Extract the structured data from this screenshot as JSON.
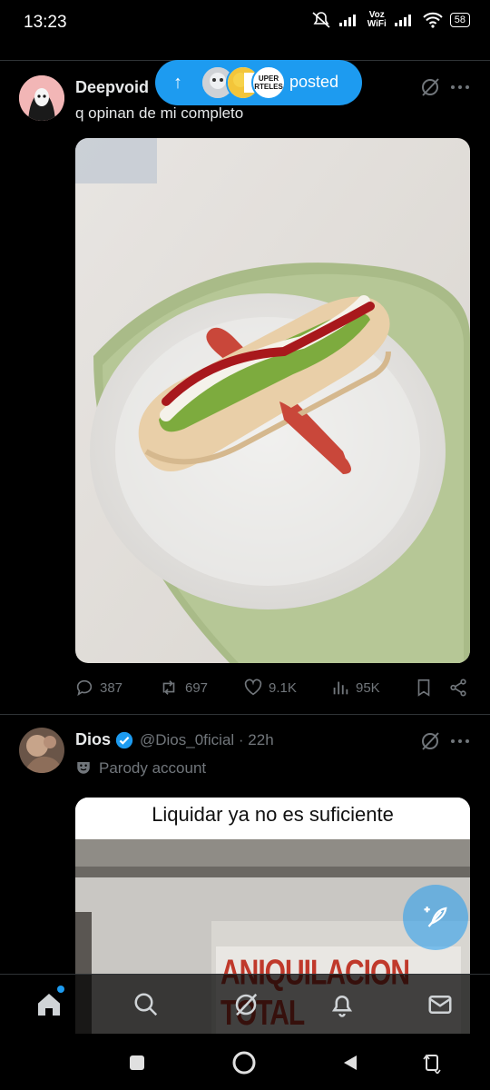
{
  "status_bar": {
    "time": "13:23",
    "network_label_top": "Voz",
    "network_label_bottom": "WiFi",
    "battery": "58"
  },
  "posted_pill": {
    "arrow": "↑",
    "label": "posted",
    "badge_text": "UPER RTELES"
  },
  "post1": {
    "name": "Deepvoid",
    "text": "q opinan de mi completo",
    "stats": {
      "replies": "387",
      "reposts": "697",
      "likes": "9.1K",
      "views": "95K"
    }
  },
  "post2": {
    "name": "Dios",
    "handle": "@Dios_0ficial · 22h",
    "parody_label": "Parody account",
    "image_caption": "Liquidar ya no es suficiente",
    "sign_text": "ANIQUILACION TOTAL"
  },
  "icons": {
    "grok": "grok-icon",
    "more": "more-icon",
    "verified": "verified-badge-icon",
    "parody": "theater-mask-icon"
  },
  "colors": {
    "accent": "#1d9bf0",
    "muted": "#71767b",
    "background": "#000000"
  }
}
